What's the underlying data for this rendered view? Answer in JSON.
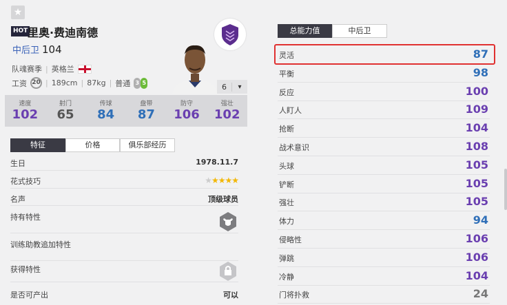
{
  "player": {
    "badge": "HOT",
    "name": "里奥·费迪南德",
    "position": "中后卫",
    "overall": "104",
    "season": "队魂赛季",
    "nationality": "英格兰",
    "salary_label": "工资",
    "salary": "20",
    "height": "189cm",
    "weight": "87kg",
    "body_type": "普通",
    "weak_foot": "3",
    "strong_foot": "5",
    "rank": "6"
  },
  "stats_bar": [
    {
      "label": "速度",
      "value": "102",
      "color": "#6a3fb0"
    },
    {
      "label": "射门",
      "value": "65",
      "color": "#555555"
    },
    {
      "label": "传球",
      "value": "84",
      "color": "#2f6fb8"
    },
    {
      "label": "盘带",
      "value": "87",
      "color": "#2f6fb8"
    },
    {
      "label": "防守",
      "value": "106",
      "color": "#6a3fb0"
    },
    {
      "label": "强壮",
      "value": "102",
      "color": "#6a3fb0"
    }
  ],
  "left_tabs": [
    "特征",
    "价格",
    "俱乐部经历"
  ],
  "info": {
    "birthday_label": "生日",
    "birthday": "1978.11.7",
    "skill_moves_label": "花式技巧",
    "skill_stars": 4,
    "reputation_label": "名声",
    "reputation": "顶级球员",
    "traits_label": "持有特性",
    "coach_traits_label": "训练助教追加特性",
    "acquired_traits_label": "获得特性",
    "producible_label": "是否可产出",
    "producible": "可以"
  },
  "right_tabs": [
    "总能力值",
    "中后卫"
  ],
  "attributes": [
    {
      "name": "灵活",
      "value": "87",
      "color": "#2f6fb8"
    },
    {
      "name": "平衡",
      "value": "98",
      "color": "#2f6fb8"
    },
    {
      "name": "反应",
      "value": "100",
      "color": "#6a3fb0"
    },
    {
      "name": "人盯人",
      "value": "109",
      "color": "#6a3fb0"
    },
    {
      "name": "抢断",
      "value": "104",
      "color": "#6a3fb0"
    },
    {
      "name": "战术意识",
      "value": "108",
      "color": "#6a3fb0"
    },
    {
      "name": "头球",
      "value": "105",
      "color": "#6a3fb0"
    },
    {
      "name": "铲断",
      "value": "105",
      "color": "#6a3fb0"
    },
    {
      "name": "强壮",
      "value": "105",
      "color": "#6a3fb0"
    },
    {
      "name": "体力",
      "value": "94",
      "color": "#2f6fb8"
    },
    {
      "name": "侵略性",
      "value": "106",
      "color": "#6a3fb0"
    },
    {
      "name": "弹跳",
      "value": "106",
      "color": "#6a3fb0"
    },
    {
      "name": "冷静",
      "value": "104",
      "color": "#6a3fb0"
    },
    {
      "name": "门将扑救",
      "value": "24",
      "color": "#777777"
    }
  ]
}
